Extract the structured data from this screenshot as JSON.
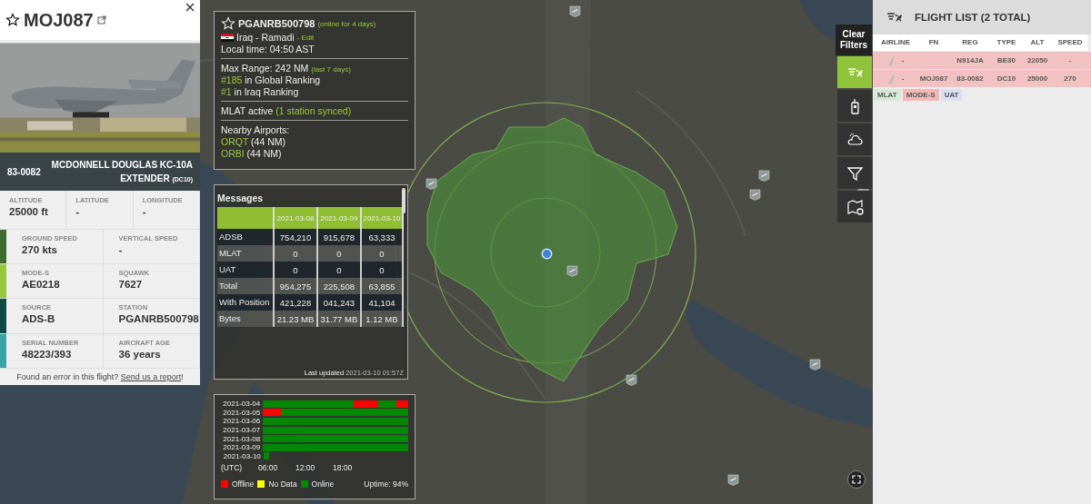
{
  "flight_panel": {
    "callsign": "MOJ087",
    "favorite": false,
    "registration": "83-0082",
    "aircraft": "MCDONNELL DOUGLAS KC-10A EXTENDER",
    "type_code": "(DC10)",
    "position_fields": [
      {
        "label": "ALTITUDE",
        "value": "25000 ft"
      },
      {
        "label": "LATITUDE",
        "value": "-"
      },
      {
        "label": "LONGITUDE",
        "value": "-"
      }
    ],
    "detail_rows": [
      {
        "color": "#3d6b31",
        "fields": [
          {
            "label": "GROUND SPEED",
            "value": "270 kts"
          },
          {
            "label": "VERTICAL SPEED",
            "value": "-"
          }
        ]
      },
      {
        "color": "#95c93d",
        "fields": [
          {
            "label": "MODE-S",
            "value": "AE0218"
          },
          {
            "label": "SQUAWK",
            "value": "7627"
          }
        ]
      },
      {
        "color": "#0e4a48",
        "fields": [
          {
            "label": "SOURCE",
            "value": "ADS-B"
          },
          {
            "label": "STATION",
            "value": "PGANRB500798"
          }
        ]
      },
      {
        "color": "#3aa1a6",
        "fields": [
          {
            "label": "SERIAL NUMBER",
            "value": "48223/393"
          },
          {
            "label": "AIRCRAFT AGE",
            "value": "36 years"
          }
        ]
      }
    ],
    "report_text": "Found an error in this flight?",
    "report_link": "Send us a report",
    "report_end": "!"
  },
  "station": {
    "name": "PGANRB500798",
    "favorite": false,
    "online_note": "(online for 4 days)",
    "location": "Iraq - Ramadi",
    "edit": "- Edit",
    "local_time": "Local time: 04:50 AST",
    "max_range": "Max Range: 242 NM",
    "range_note": "(last 7 days)",
    "rankings": [
      {
        "rank": "#185",
        "text": "in Global Ranking"
      },
      {
        "rank": "#1",
        "text": "in Iraq Ranking"
      }
    ],
    "mlat": "MLAT active",
    "mlat_note": "(1 station synced)",
    "nearby_title": "Nearby Airports:",
    "airports": [
      {
        "code": "ORQT",
        "distance": "(44 NM)"
      },
      {
        "code": "ORBI",
        "distance": "(44 NM)"
      }
    ]
  },
  "messages": {
    "title": "Messages",
    "columns": [
      "2021-03-08",
      "2021-03-09",
      "2021-03-10"
    ],
    "rows": [
      {
        "label": "ADSB",
        "values": [
          "754,210",
          "915,678",
          "63,333"
        ]
      },
      {
        "label": "MLAT",
        "values": [
          "0",
          "0",
          "0"
        ]
      },
      {
        "label": "UAT",
        "values": [
          "0",
          "0",
          "0"
        ]
      },
      {
        "label": "Total",
        "values": [
          "954,275",
          "225,508",
          "63,855"
        ]
      },
      {
        "label": "With Position",
        "values": [
          "421,228",
          "041,243",
          "41,104"
        ]
      },
      {
        "label": "Bytes",
        "values": [
          "21.23 MB",
          "31.77 MB",
          "1.12 MB"
        ]
      }
    ],
    "last_updated_label": "Last updated",
    "last_updated": "2021-03-10 01:57Z"
  },
  "uptime": {
    "rows": [
      {
        "date": "2021-03-04",
        "hours": [
          {
            "kind": "online"
          },
          {
            "kind": "online"
          },
          {
            "kind": "online"
          },
          {
            "kind": "online"
          },
          {
            "kind": "online"
          },
          {
            "kind": "online"
          },
          {
            "kind": "online"
          },
          {
            "kind": "online"
          },
          {
            "kind": "online"
          },
          {
            "kind": "online"
          },
          {
            "kind": "online"
          },
          {
            "kind": "online"
          },
          {
            "kind": "online"
          },
          {
            "kind": "online"
          },
          {
            "kind": "online"
          },
          {
            "kind": "offline"
          },
          {
            "kind": "offline"
          },
          {
            "kind": "offline"
          },
          {
            "kind": "offline"
          },
          {
            "kind": "online"
          },
          {
            "kind": "online"
          },
          {
            "kind": "online"
          },
          {
            "kind": "offline"
          },
          {
            "kind": "offline"
          }
        ]
      },
      {
        "date": "2021-03-05",
        "hours": [
          {
            "kind": "offline"
          },
          {
            "kind": "offline"
          },
          {
            "kind": "offline"
          },
          {
            "kind": "online"
          },
          {
            "kind": "online"
          },
          {
            "kind": "online"
          },
          {
            "kind": "online"
          },
          {
            "kind": "online"
          },
          {
            "kind": "online"
          },
          {
            "kind": "online"
          },
          {
            "kind": "online"
          },
          {
            "kind": "online"
          },
          {
            "kind": "online"
          },
          {
            "kind": "online"
          },
          {
            "kind": "online"
          },
          {
            "kind": "online"
          },
          {
            "kind": "online"
          },
          {
            "kind": "online"
          },
          {
            "kind": "online"
          },
          {
            "kind": "online"
          },
          {
            "kind": "online"
          },
          {
            "kind": "online"
          },
          {
            "kind": "online"
          },
          {
            "kind": "online"
          }
        ]
      },
      {
        "date": "2021-03-06",
        "hours": [
          {
            "kind": "online"
          },
          {
            "kind": "online"
          },
          {
            "kind": "online"
          },
          {
            "kind": "online"
          },
          {
            "kind": "online"
          },
          {
            "kind": "online"
          },
          {
            "kind": "online"
          },
          {
            "kind": "online"
          },
          {
            "kind": "online"
          },
          {
            "kind": "online"
          },
          {
            "kind": "online"
          },
          {
            "kind": "online"
          },
          {
            "kind": "online"
          },
          {
            "kind": "online"
          },
          {
            "kind": "online"
          },
          {
            "kind": "online"
          },
          {
            "kind": "online"
          },
          {
            "kind": "online"
          },
          {
            "kind": "online"
          },
          {
            "kind": "online"
          },
          {
            "kind": "online"
          },
          {
            "kind": "online"
          },
          {
            "kind": "online"
          },
          {
            "kind": "online"
          }
        ]
      },
      {
        "date": "2021-03-07",
        "hours": [
          {
            "kind": "online"
          },
          {
            "kind": "online"
          },
          {
            "kind": "online"
          },
          {
            "kind": "online"
          },
          {
            "kind": "online"
          },
          {
            "kind": "online"
          },
          {
            "kind": "online"
          },
          {
            "kind": "online"
          },
          {
            "kind": "online"
          },
          {
            "kind": "online"
          },
          {
            "kind": "online"
          },
          {
            "kind": "online"
          },
          {
            "kind": "online"
          },
          {
            "kind": "online"
          },
          {
            "kind": "online"
          },
          {
            "kind": "online"
          },
          {
            "kind": "online"
          },
          {
            "kind": "online"
          },
          {
            "kind": "online"
          },
          {
            "kind": "online"
          },
          {
            "kind": "online"
          },
          {
            "kind": "online"
          },
          {
            "kind": "online"
          },
          {
            "kind": "online"
          }
        ]
      },
      {
        "date": "2021-03-08",
        "hours": [
          {
            "kind": "online"
          },
          {
            "kind": "online"
          },
          {
            "kind": "online"
          },
          {
            "kind": "online"
          },
          {
            "kind": "online"
          },
          {
            "kind": "online"
          },
          {
            "kind": "online"
          },
          {
            "kind": "online"
          },
          {
            "kind": "online"
          },
          {
            "kind": "online"
          },
          {
            "kind": "online"
          },
          {
            "kind": "online"
          },
          {
            "kind": "online"
          },
          {
            "kind": "online"
          },
          {
            "kind": "online"
          },
          {
            "kind": "online"
          },
          {
            "kind": "online"
          },
          {
            "kind": "online"
          },
          {
            "kind": "online"
          },
          {
            "kind": "online"
          },
          {
            "kind": "online"
          },
          {
            "kind": "online"
          },
          {
            "kind": "online"
          },
          {
            "kind": "online"
          }
        ]
      },
      {
        "date": "2021-03-09",
        "hours": [
          {
            "kind": "online"
          },
          {
            "kind": "online"
          },
          {
            "kind": "online"
          },
          {
            "kind": "online"
          },
          {
            "kind": "online"
          },
          {
            "kind": "online"
          },
          {
            "kind": "online"
          },
          {
            "kind": "online"
          },
          {
            "kind": "online"
          },
          {
            "kind": "online"
          },
          {
            "kind": "online"
          },
          {
            "kind": "online"
          },
          {
            "kind": "online"
          },
          {
            "kind": "online"
          },
          {
            "kind": "online"
          },
          {
            "kind": "online"
          },
          {
            "kind": "online"
          },
          {
            "kind": "online"
          },
          {
            "kind": "online"
          },
          {
            "kind": "online"
          },
          {
            "kind": "online"
          },
          {
            "kind": "online"
          },
          {
            "kind": "online"
          },
          {
            "kind": "online"
          }
        ]
      },
      {
        "date": "2021-03-10",
        "hours": [
          {
            "kind": "online"
          }
        ]
      }
    ],
    "axis": [
      "(UTC)",
      "06:00",
      "12:00",
      "18:00"
    ],
    "legend": [
      {
        "label": "Offline",
        "color": "#ff0000"
      },
      {
        "label": "No Data",
        "color": "#ffff00"
      },
      {
        "label": "Online",
        "color": "#008800"
      }
    ],
    "uptime": "Uptime: 94%"
  },
  "toolbar": {
    "clear_filters": "Clear Filters",
    "tools": [
      {
        "kind": "flight-list",
        "selected": true
      },
      {
        "kind": "radio",
        "selected": false
      },
      {
        "kind": "weather",
        "selected": false
      },
      {
        "kind": "filter",
        "selected": false
      },
      {
        "kind": "map-settings",
        "selected": false
      }
    ]
  },
  "flight_list": {
    "title": "FLIGHT LIST (2 TOTAL)",
    "columns": [
      "AIRLINE",
      "FN",
      "REG",
      "TYPE",
      "ALT",
      "SPEED"
    ],
    "rows": [
      {
        "color": "#f2c2c2",
        "airline": "-",
        "reg": "N914JA",
        "type": "BE30",
        "alt": "22050",
        "speed": "-"
      },
      {
        "color": "#f2c2c2",
        "airline": "-",
        "fn": "MOJ087",
        "reg": "83-0082",
        "type": "DC10",
        "alt": "25000",
        "speed": "270"
      }
    ],
    "tags": [
      {
        "label": "MLAT",
        "color": "#d6e9d6"
      },
      {
        "label": "MODE-S",
        "color": "#f2b8b8"
      },
      {
        "label": "UAT",
        "color": "#dcdcf5"
      }
    ]
  }
}
